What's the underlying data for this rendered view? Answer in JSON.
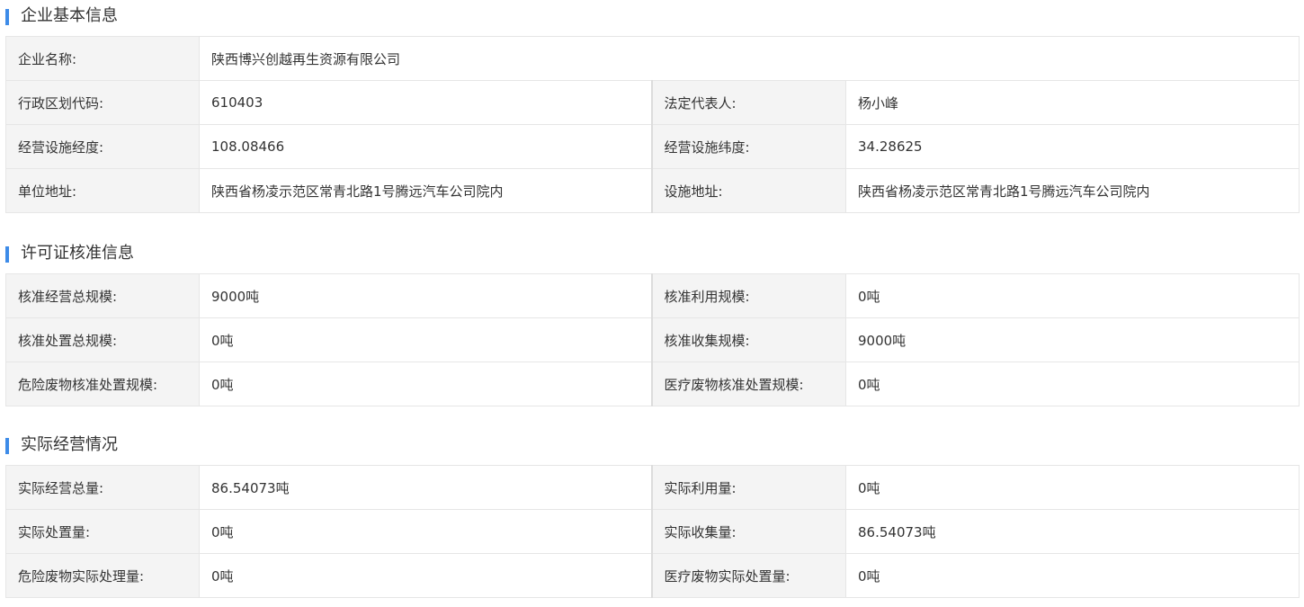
{
  "sections": [
    {
      "title": "企业基本信息",
      "rows": [
        [
          {
            "label": "企业名称:",
            "value": "陕西博兴创越再生资源有限公司"
          }
        ],
        [
          {
            "label": "行政区划代码:",
            "value": "610403"
          },
          {
            "label": "法定代表人:",
            "value": "杨小峰"
          }
        ],
        [
          {
            "label": "经营设施经度:",
            "value": "108.08466"
          },
          {
            "label": "经营设施纬度:",
            "value": "34.28625"
          }
        ],
        [
          {
            "label": "单位地址:",
            "value": "陕西省杨凌示范区常青北路1号腾远汽车公司院内"
          },
          {
            "label": "设施地址:",
            "value": "陕西省杨凌示范区常青北路1号腾远汽车公司院内"
          }
        ]
      ]
    },
    {
      "title": "许可证核准信息",
      "rows": [
        [
          {
            "label": "核准经营总规模:",
            "value": "9000吨"
          },
          {
            "label": "核准利用规模:",
            "value": "0吨"
          }
        ],
        [
          {
            "label": "核准处置总规模:",
            "value": "0吨"
          },
          {
            "label": "核准收集规模:",
            "value": "9000吨"
          }
        ],
        [
          {
            "label": "危险废物核准处置规模:",
            "value": "0吨"
          },
          {
            "label": "医疗废物核准处置规模:",
            "value": "0吨"
          }
        ]
      ]
    },
    {
      "title": "实际经营情况",
      "rows": [
        [
          {
            "label": "实际经营总量:",
            "value": "86.54073吨"
          },
          {
            "label": "实际利用量:",
            "value": "0吨"
          }
        ],
        [
          {
            "label": "实际处置量:",
            "value": "0吨"
          },
          {
            "label": "实际收集量:",
            "value": "86.54073吨"
          }
        ],
        [
          {
            "label": "危险废物实际处理量:",
            "value": "0吨"
          },
          {
            "label": "医疗废物实际处置量:",
            "value": "0吨"
          }
        ]
      ]
    }
  ],
  "colors": {
    "accent": "#3d8be8",
    "label_bg": "#f4f4f4",
    "border": "#e6e6e6"
  }
}
